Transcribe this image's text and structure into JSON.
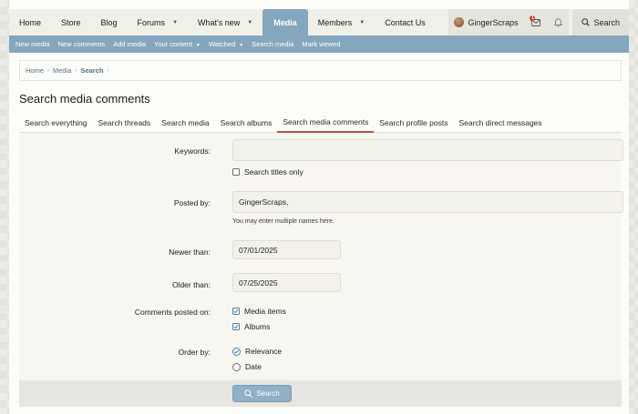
{
  "nav": {
    "items": [
      {
        "label": "Home",
        "dropdown": false
      },
      {
        "label": "Store",
        "dropdown": false
      },
      {
        "label": "Blog",
        "dropdown": false
      },
      {
        "label": "Forums",
        "dropdown": true
      },
      {
        "label": "What's new",
        "dropdown": true
      },
      {
        "label": "Media",
        "dropdown": false,
        "active": true
      },
      {
        "label": "Members",
        "dropdown": true
      },
      {
        "label": "Contact Us",
        "dropdown": false
      }
    ],
    "username": "GingerScraps",
    "inbox_badge": "1",
    "search_label": "Search"
  },
  "subnav": {
    "items": [
      {
        "label": "New media",
        "dropdown": false
      },
      {
        "label": "New comments",
        "dropdown": false
      },
      {
        "label": "Add media",
        "dropdown": false
      },
      {
        "label": "Your content",
        "dropdown": true
      },
      {
        "label": "Watched",
        "dropdown": true
      },
      {
        "label": "Search media",
        "dropdown": false
      },
      {
        "label": "Mark viewed",
        "dropdown": false
      }
    ]
  },
  "breadcrumb": [
    "Home",
    "Media",
    "Search"
  ],
  "page_title": "Search media comments",
  "tabs": [
    {
      "label": "Search everything"
    },
    {
      "label": "Search threads"
    },
    {
      "label": "Search media"
    },
    {
      "label": "Search albums"
    },
    {
      "label": "Search media comments",
      "active": true
    },
    {
      "label": "Search profile posts"
    },
    {
      "label": "Search direct messages"
    }
  ],
  "form": {
    "keywords_label": "Keywords:",
    "keywords_value": "",
    "titles_only_label": "Search titles only",
    "titles_only_checked": false,
    "posted_by_label": "Posted by:",
    "posted_by_value": "GingerScraps,",
    "posted_by_hint": "You may enter multiple names here.",
    "newer_than_label": "Newer than:",
    "newer_than_value": "07/01/2025",
    "older_than_label": "Older than:",
    "older_than_value": "07/25/2025",
    "comments_on_label": "Comments posted on:",
    "media_items_label": "Media items",
    "media_items_checked": true,
    "albums_label": "Albums",
    "albums_checked": true,
    "order_by_label": "Order by:",
    "order_relevance_label": "Relevance",
    "order_date_label": "Date",
    "order_selected": "relevance",
    "submit_label": "Search"
  },
  "colors": {
    "accent": "#85a7bd",
    "tab_underline": "#b8503d",
    "badge": "#d23a2a"
  }
}
